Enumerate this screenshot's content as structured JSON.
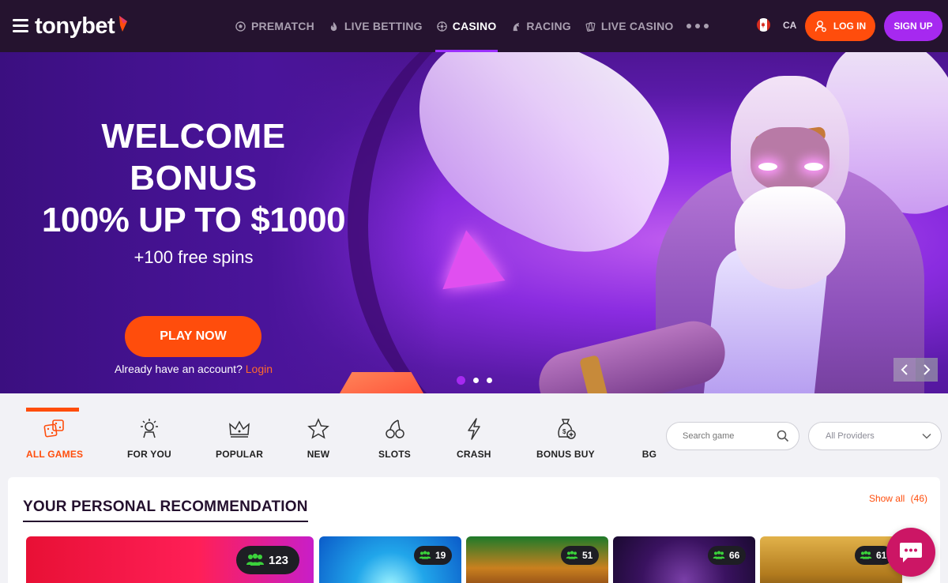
{
  "header": {
    "brand": "tonybet",
    "nav": [
      {
        "label": "PREMATCH",
        "icon": "soccer-ball-icon",
        "active": false
      },
      {
        "label": "LIVE BETTING",
        "icon": "flame-icon",
        "active": false
      },
      {
        "label": "CASINO",
        "icon": "roulette-icon",
        "active": true
      },
      {
        "label": "RACING",
        "icon": "horse-icon",
        "active": false
      },
      {
        "label": "LIVE CASINO",
        "icon": "cards-icon",
        "active": false
      }
    ],
    "lang_code": "CA",
    "login_label": "LOG IN",
    "signup_label": "SIGN UP",
    "colors": {
      "bg": "#25132f",
      "accent_orange": "#ff4d0c",
      "accent_purple": "#a629f0"
    }
  },
  "hero": {
    "line1": "WELCOME",
    "line2": "BONUS",
    "line3": "100% UP TO $1000",
    "subline": "+100 free spins",
    "play_label": "PLAY NOW",
    "account_text": "Already have an account?",
    "login_link": "Login",
    "slides": 3,
    "active_slide": 1
  },
  "categories": {
    "items": [
      {
        "label": "ALL GAMES",
        "icon": "dice-icon",
        "active": true
      },
      {
        "label": "FOR YOU",
        "icon": "for-you-icon",
        "active": false
      },
      {
        "label": "POPULAR",
        "icon": "crown-icon",
        "active": false
      },
      {
        "label": "NEW",
        "icon": "star-icon",
        "active": false
      },
      {
        "label": "SLOTS",
        "icon": "cherry-icon",
        "active": false
      },
      {
        "label": "CRASH",
        "icon": "lightning-icon",
        "active": false
      },
      {
        "label": "BONUS BUY",
        "icon": "money-bag-icon",
        "active": false
      },
      {
        "label": "BG",
        "icon": "",
        "active": false
      }
    ],
    "search_placeholder": "Search game",
    "providers_label": "All Providers"
  },
  "recommendations": {
    "title": "YOUR PERSONAL RECOMMENDATION",
    "show_all": "Show all",
    "count": "(46)",
    "tiles": [
      {
        "players": "123"
      },
      {
        "players": "19"
      },
      {
        "players": "51"
      },
      {
        "players": "66"
      },
      {
        "players": "61"
      }
    ]
  }
}
